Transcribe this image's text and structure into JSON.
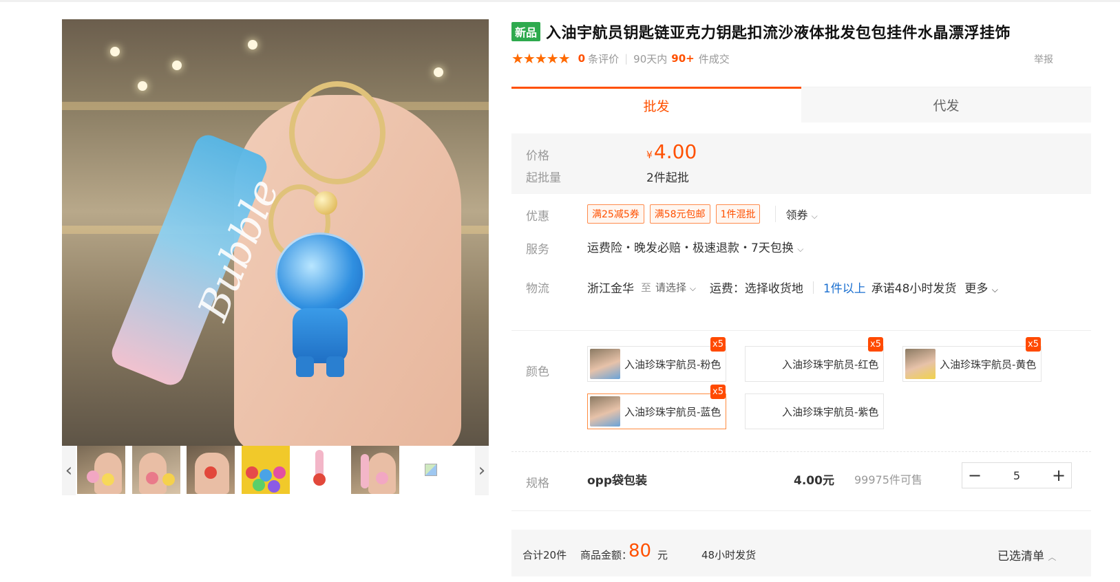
{
  "product": {
    "new_badge": "新品",
    "title": "入油宇航员钥匙链亚克力钥匙扣流沙液体批发包包挂件水晶漂浮挂饰",
    "stars": "★★★★★",
    "review_count": "0",
    "review_label": "条评价",
    "days_label": "90天内",
    "sold_count": "90+",
    "sold_label": "件成交",
    "report": "举报",
    "rating": 5
  },
  "gallery": {
    "main_image_text": "Bubble",
    "thumbnails": [
      "thumb-1",
      "thumb-2",
      "thumb-3",
      "thumb-4",
      "thumb-5",
      "thumb-6",
      "thumb-7"
    ],
    "prev_icon": "‹",
    "next_icon": "›"
  },
  "tabs": [
    {
      "label": "批发",
      "active": true
    },
    {
      "label": "代发",
      "active": false
    }
  ],
  "price": {
    "price_label": "价格",
    "currency": "¥",
    "value": "4.00",
    "moq_label": "起批量",
    "moq_value": "2件起批"
  },
  "promos": {
    "label": "优惠",
    "coupons": [
      "满25减5券",
      "满58元包邮",
      "1件混批"
    ],
    "get_coupon": "领券"
  },
  "service": {
    "label": "服务",
    "text": "运费险・晚发必赔・极速退款・7天包换"
  },
  "logistics": {
    "label": "物流",
    "origin": "浙江金华",
    "to": "至",
    "select": "请选择",
    "fee": "运费：选择收货地",
    "qty": "1件以上",
    "promise": "承诺48小时发货",
    "more": "更多"
  },
  "colors": {
    "label": "颜色",
    "options": [
      {
        "label": "入油珍珠宇航员-粉色",
        "badge": "x5",
        "has_image": true,
        "selected": false
      },
      {
        "label": "入油珍珠宇航员-红色",
        "badge": "x5",
        "has_image": false,
        "selected": false
      },
      {
        "label": "入油珍珠宇航员-黄色",
        "badge": "x5",
        "has_image": true,
        "selected": false
      },
      {
        "label": "入油珍珠宇航员-蓝色",
        "badge": "x5",
        "has_image": true,
        "selected": true
      },
      {
        "label": "入油珍珠宇航员-紫色",
        "badge": "",
        "has_image": false,
        "selected": false
      }
    ]
  },
  "spec": {
    "label": "规格",
    "name": "opp袋包装",
    "price": "4.00元",
    "stock": "99975件可售",
    "quantity": "5",
    "minus": "−",
    "plus": "+"
  },
  "summary": {
    "total_count": "合计20件",
    "amount_label": "商品金额：",
    "amount": "80",
    "unit": "元",
    "ship": "48小时发货",
    "cart": "已选清单"
  },
  "colors_theme": {
    "accent": "#ff5000",
    "new_badge": "#2eaa4e",
    "link_blue": "#1a6fd0"
  }
}
